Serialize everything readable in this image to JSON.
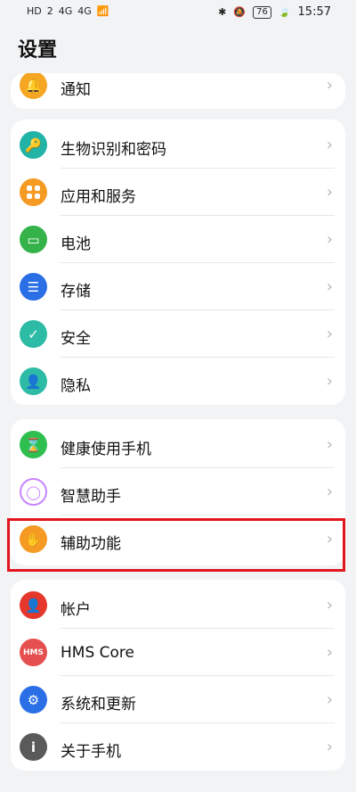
{
  "status": {
    "left_icons": [
      "HD",
      "2",
      "4G",
      "4G",
      "wifi"
    ],
    "time": "15:57",
    "battery": "76"
  },
  "page": {
    "title": "设置"
  },
  "groups": [
    {
      "items": [
        {
          "label": "通知",
          "icon": "bell-icon",
          "color": "#f5a623"
        }
      ]
    },
    {
      "items": [
        {
          "label": "生物识别和密码",
          "icon": "key-icon",
          "color": "#22b3a7"
        },
        {
          "label": "应用和服务",
          "icon": "apps-icon",
          "color": "#f59a23"
        },
        {
          "label": "电池",
          "icon": "battery-icon",
          "color": "#35b34a"
        },
        {
          "label": "存储",
          "icon": "storage-icon",
          "color": "#2a6fe6"
        },
        {
          "label": "安全",
          "icon": "shield-icon",
          "color": "#2dbba6"
        },
        {
          "label": "隐私",
          "icon": "privacy-icon",
          "color": "#2dbba6"
        }
      ]
    },
    {
      "items": [
        {
          "label": "健康使用手机",
          "icon": "hourglass-icon",
          "color": "#2fbf4e"
        },
        {
          "label": "智慧助手",
          "icon": "assistant-icon",
          "color": "#c784ff"
        },
        {
          "label": "辅助功能",
          "icon": "hand-icon",
          "color": "#f59a23"
        }
      ]
    },
    {
      "items": [
        {
          "label": "帐户",
          "icon": "account-icon",
          "color": "#e5372b"
        },
        {
          "label": "HMS Core",
          "icon": "hms-icon",
          "color": "#e64f4f"
        },
        {
          "label": "系统和更新",
          "icon": "gear-icon",
          "color": "#2a6fe6"
        },
        {
          "label": "关于手机",
          "icon": "info-icon",
          "color": "#5a5a5a"
        }
      ]
    }
  ],
  "ui": {
    "chevron": "›"
  }
}
